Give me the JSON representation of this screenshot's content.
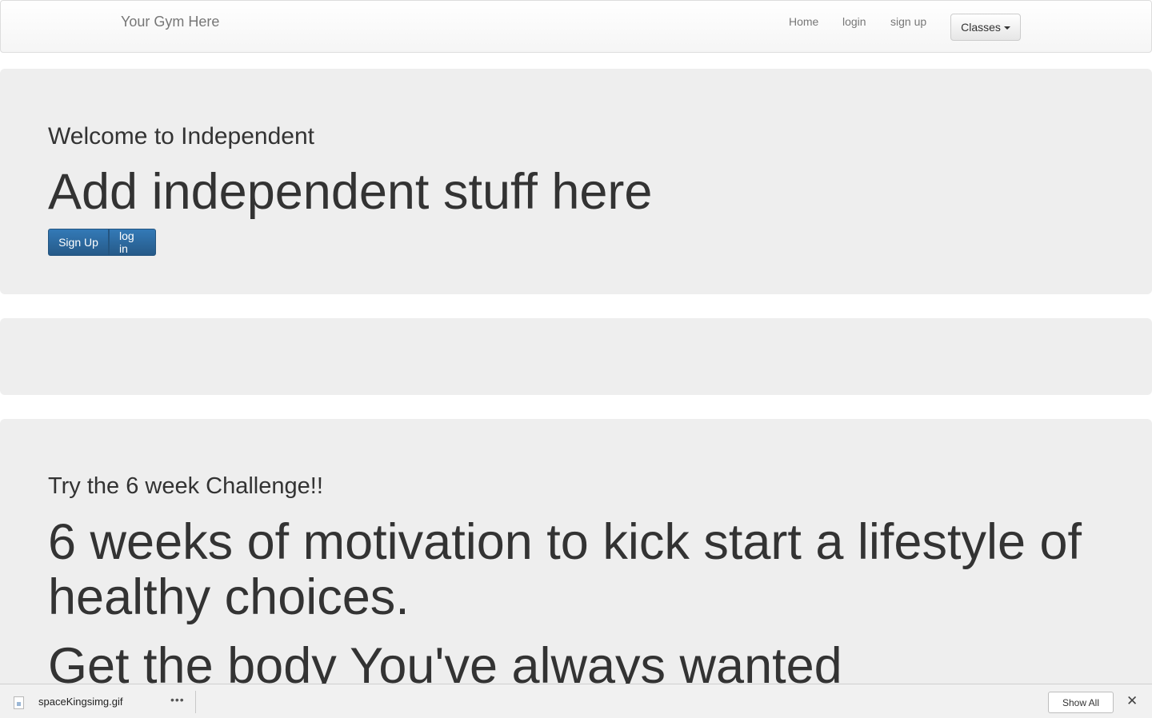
{
  "navbar": {
    "brand": "Your Gym Here",
    "links": [
      "Home",
      "login",
      "sign up"
    ],
    "classes_label": "Classes"
  },
  "hero": {
    "lead": "Welcome to Independent",
    "headline": "Add independent stuff here",
    "signup_label": "Sign Up",
    "login_label": "log in"
  },
  "challenge": {
    "lead": "Try the 6 week Challenge!!",
    "headline": "6 weeks of motivation to kick start a lifestyle of healthy choices.",
    "subheadline": "Get the body You've always wanted"
  },
  "download_bar": {
    "file_name": "spaceKingsimg.gif",
    "more_label": "•••",
    "show_all_label": "Show All",
    "close_label": "✕"
  }
}
